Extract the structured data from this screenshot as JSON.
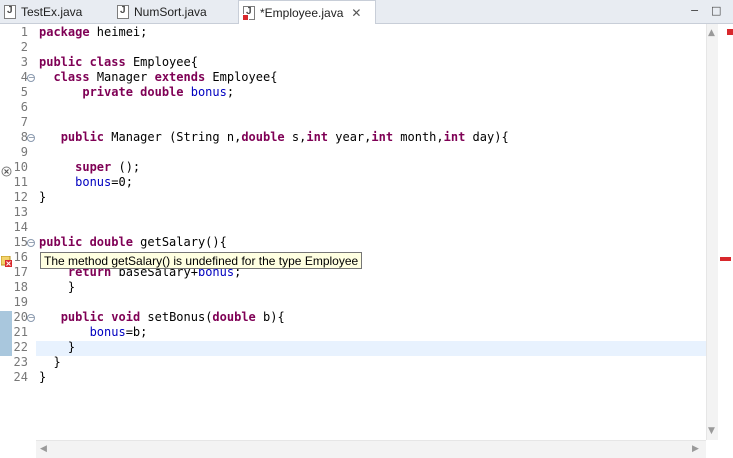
{
  "tabs": [
    {
      "label": "TestEx.java",
      "active": false,
      "error": false
    },
    {
      "label": "NumSort.java",
      "active": false,
      "error": false
    },
    {
      "label": "*Employee.java",
      "active": true,
      "error": true
    }
  ],
  "window_controls": {
    "minimize": "−",
    "maximize": "□"
  },
  "editor": {
    "lines": [
      {
        "n": "1",
        "tokens": [
          [
            "kw",
            "package"
          ],
          [
            "",
            "heimei;"
          ]
        ]
      },
      {
        "n": "2",
        "tokens": []
      },
      {
        "n": "3",
        "tokens": [
          [
            "kw",
            "public"
          ],
          [
            "",
            ""
          ],
          [
            "kw",
            "class"
          ],
          [
            "",
            "Employee{"
          ]
        ]
      },
      {
        "n": "4",
        "tokens": [
          [
            "",
            "  "
          ],
          [
            "kw",
            "class"
          ],
          [
            "",
            "Manager "
          ],
          [
            "kw",
            "extends"
          ],
          [
            "",
            "Employee{"
          ]
        ]
      },
      {
        "n": "5",
        "tokens": [
          [
            "",
            "      "
          ],
          [
            "kw",
            "private"
          ],
          [
            "",
            ""
          ],
          [
            "kw",
            "double"
          ],
          [
            "",
            ""
          ],
          [
            "fld",
            "bonus"
          ],
          [
            "",
            ";"
          ]
        ]
      },
      {
        "n": "6",
        "tokens": []
      },
      {
        "n": "7",
        "tokens": []
      },
      {
        "n": "8",
        "tokens": [
          [
            "",
            "   "
          ],
          [
            "kw",
            "public"
          ],
          [
            "",
            "Manager (String n,"
          ],
          [
            "kw",
            "double"
          ],
          [
            "",
            "s,"
          ],
          [
            "kw",
            "int"
          ],
          [
            "",
            "year,"
          ],
          [
            "kw",
            "int"
          ],
          [
            "",
            "month,"
          ],
          [
            "kw",
            "int"
          ],
          [
            "",
            "day){"
          ]
        ]
      },
      {
        "n": "9",
        "tokens": []
      },
      {
        "n": "10",
        "tokens": [
          [
            "",
            "     "
          ],
          [
            "kw",
            "super"
          ],
          [
            "",
            "();"
          ]
        ]
      },
      {
        "n": "11",
        "tokens": [
          [
            "",
            "     "
          ],
          [
            "fld",
            "bonus"
          ],
          [
            "",
            "=0;"
          ]
        ]
      },
      {
        "n": "12",
        "tokens": [
          [
            "",
            "}"
          ]
        ]
      },
      {
        "n": "13",
        "tokens": []
      },
      {
        "n": "14",
        "tokens": []
      },
      {
        "n": "15",
        "tokens": [
          [
            "kw",
            "public"
          ],
          [
            "",
            ""
          ],
          [
            "kw",
            "double"
          ],
          [
            "",
            "getSalary(){"
          ]
        ]
      },
      {
        "n": "16",
        "tokens": []
      },
      {
        "n": "17",
        "tokens": [
          [
            "",
            "    "
          ],
          [
            "kw",
            "return"
          ],
          [
            "",
            "baseSalary+"
          ],
          [
            "fld",
            "bonus"
          ],
          [
            "",
            ";"
          ]
        ]
      },
      {
        "n": "18",
        "tokens": [
          [
            "",
            "    }"
          ]
        ]
      },
      {
        "n": "19",
        "tokens": []
      },
      {
        "n": "20",
        "tokens": [
          [
            "",
            "   "
          ],
          [
            "kw",
            "public"
          ],
          [
            "",
            ""
          ],
          [
            "kw",
            "void"
          ],
          [
            "",
            "setBonus("
          ],
          [
            "kw",
            "double"
          ],
          [
            "",
            "b){"
          ]
        ]
      },
      {
        "n": "21",
        "tokens": [
          [
            "",
            "       "
          ],
          [
            "fld",
            "bonus"
          ],
          [
            "",
            "=b;"
          ]
        ]
      },
      {
        "n": "22",
        "tokens": [
          [
            "",
            "    }"
          ]
        ]
      },
      {
        "n": "23",
        "tokens": [
          [
            "",
            "  }"
          ]
        ]
      },
      {
        "n": "24",
        "tokens": [
          [
            "",
            "}"
          ]
        ]
      }
    ]
  },
  "tooltip": {
    "text": "The method getSalary() is undefined for the type Employee"
  },
  "colors": {
    "keyword": "#7f0055",
    "field": "#0000c0",
    "current_line": "#e8f2fe",
    "error": "#d8282c"
  }
}
